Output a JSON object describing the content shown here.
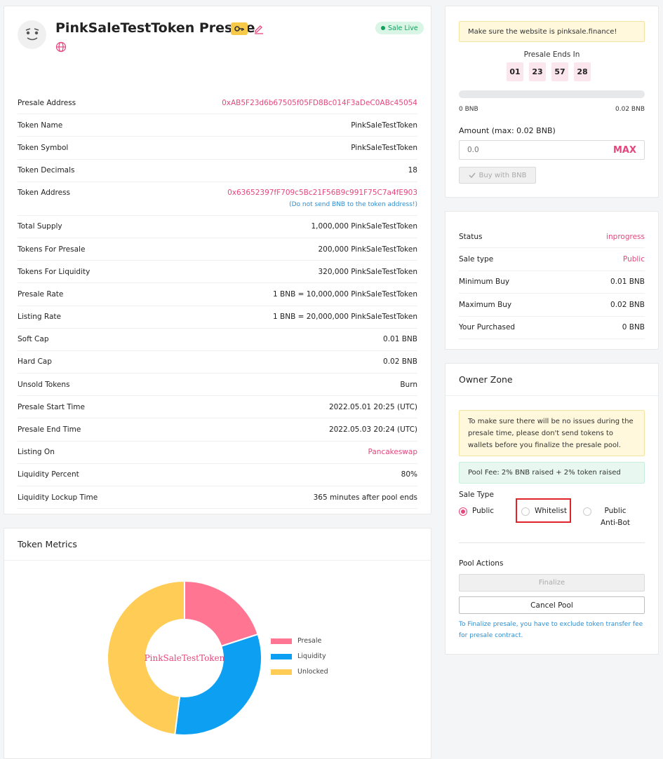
{
  "presale": {
    "title": "PinkSaleTestToken Presale",
    "badge": "Sale Live",
    "icons": {
      "avatar": "token-logo",
      "key": "key-icon",
      "edit": "edit-icon",
      "globe": "globe-icon"
    }
  },
  "info": [
    {
      "label": "Presale Address",
      "value": "0xAB5F23d6b67505f05FD8Bc014F3aDeC0ABc45054",
      "link": true
    },
    {
      "label": "Token Name",
      "value": "PinkSaleTestToken"
    },
    {
      "label": "Token Symbol",
      "value": "PinkSaleTestToken"
    },
    {
      "label": "Token Decimals",
      "value": "18"
    },
    {
      "label": "Token Address",
      "value": "0x63652397fF709c5Bc21F56B9c991F75C7a4fE903",
      "note": "(Do not send BNB to the token address!)",
      "link": true
    },
    {
      "label": "Total Supply",
      "value": "1,000,000 PinkSaleTestToken"
    },
    {
      "label": "Tokens For Presale",
      "value": "200,000 PinkSaleTestToken"
    },
    {
      "label": "Tokens For Liquidity",
      "value": "320,000 PinkSaleTestToken"
    },
    {
      "label": "Presale Rate",
      "value": "1 BNB = 10,000,000 PinkSaleTestToken"
    },
    {
      "label": "Listing Rate",
      "value": "1 BNB = 20,000,000 PinkSaleTestToken"
    },
    {
      "label": "Soft Cap",
      "value": "0.01 BNB"
    },
    {
      "label": "Hard Cap",
      "value": "0.02 BNB"
    },
    {
      "label": "Unsold Tokens",
      "value": "Burn"
    },
    {
      "label": "Presale Start Time",
      "value": "2022.05.01 20:25 (UTC)"
    },
    {
      "label": "Presale End Time",
      "value": "2022.05.03 20:24 (UTC)"
    },
    {
      "label": "Listing On",
      "value": "Pancakeswap",
      "link": true
    },
    {
      "label": "Liquidity Percent",
      "value": "80%"
    },
    {
      "label": "Liquidity Lockup Time",
      "value": "365 minutes after pool ends"
    }
  ],
  "metrics": {
    "title": "Token Metrics",
    "center_label": "PinkSaleTestToken"
  },
  "chart_data": {
    "type": "pie",
    "donut": true,
    "title": "",
    "center_label": "PinkSaleTestToken",
    "legend_position": "right",
    "series": [
      {
        "name": "Presale",
        "value": 200000,
        "color": "#ff7592"
      },
      {
        "name": "Liquidity",
        "value": 320000,
        "color": "#0c9ff2"
      },
      {
        "name": "Unlocked",
        "value": 480000,
        "color": "#ffcc55"
      }
    ]
  },
  "buy": {
    "notice": "Make sure the website is pinksale.finance!",
    "ends_label": "Presale Ends In",
    "countdown": [
      "01",
      "23",
      "57",
      "28"
    ],
    "progress_fraction": 0.0,
    "progress_min": "0 BNB",
    "progress_max": "0.02 BNB",
    "amount_label": "Amount (max: 0.02 BNB)",
    "amount_placeholder": "0.0",
    "max_label": "MAX",
    "buy_label": "Buy with BNB"
  },
  "status": [
    {
      "label": "Status",
      "value": "inprogress",
      "pink": true
    },
    {
      "label": "Sale type",
      "value": "Public",
      "pink": true
    },
    {
      "label": "Minimum Buy",
      "value": "0.01 BNB"
    },
    {
      "label": "Maximum Buy",
      "value": "0.02 BNB"
    },
    {
      "label": "Your Purchased",
      "value": "0 BNB"
    }
  ],
  "owner": {
    "title": "Owner Zone",
    "note": "To make sure there will be no issues during the presale time, please don't send tokens to wallets before you finalize the presale pool.",
    "pool_fee": "Pool Fee: 2% BNB raised + 2% token raised",
    "sale_type_label": "Sale Type",
    "options": [
      "Public",
      "Whitelist",
      "Public Anti-Bot"
    ],
    "selected": "Public",
    "pool_actions_label": "Pool Actions",
    "finalize_label": "Finalize",
    "cancel_label": "Cancel Pool",
    "finalize_note": "To Finalize presale, you have to exclude token transfer fee for presale contract."
  },
  "colors": {
    "accent": "#e5467d",
    "live": "#11a15d",
    "link_blue": "#2d8fd1",
    "highlight": "#e0232a"
  }
}
